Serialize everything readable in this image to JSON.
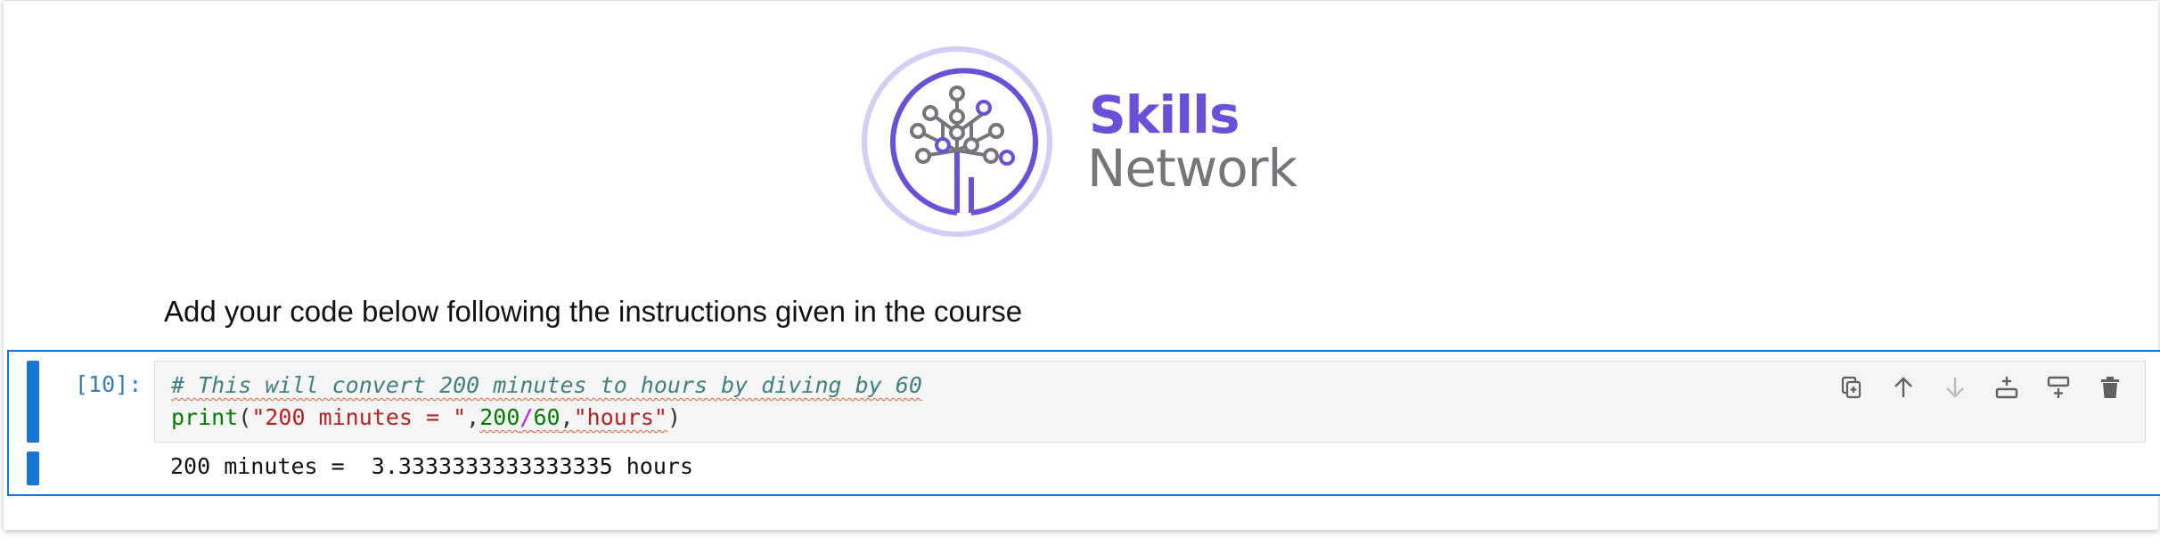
{
  "banner": {
    "brand_word1": "Skills",
    "brand_word2": "Network",
    "logo_icon": "skills-network-tree-logo",
    "colors": {
      "purple": "#6a4fd9",
      "light_purple": "#d5cdf5",
      "gray": "#75767a"
    }
  },
  "markdown": {
    "text": "Add your code below following the instructions given in the course"
  },
  "cell": {
    "prompt": "[10]:",
    "code": {
      "comment": "# This will convert 200 minutes to hours by diving by 60",
      "builtin": "print",
      "open_paren": "(",
      "string1": "\"200 minutes = \"",
      "comma1": ",",
      "num1": "200",
      "op": "/",
      "num2": "60",
      "comma2": ",",
      "string2": "\"hours\"",
      "close_paren": ")"
    },
    "output": "200 minutes =  3.3333333333333335 hours",
    "toolbar": {
      "items": [
        {
          "name": "duplicate-cell",
          "icon": "copy-icon"
        },
        {
          "name": "move-up",
          "icon": "arrow-up-icon"
        },
        {
          "name": "move-down",
          "icon": "arrow-down-icon"
        },
        {
          "name": "insert-above",
          "icon": "insert-above-icon"
        },
        {
          "name": "insert-below",
          "icon": "insert-below-icon"
        },
        {
          "name": "delete-cell",
          "icon": "trash-icon"
        }
      ]
    },
    "colors": {
      "active_border": "#1976d2",
      "prompt": "#307fc1"
    }
  }
}
